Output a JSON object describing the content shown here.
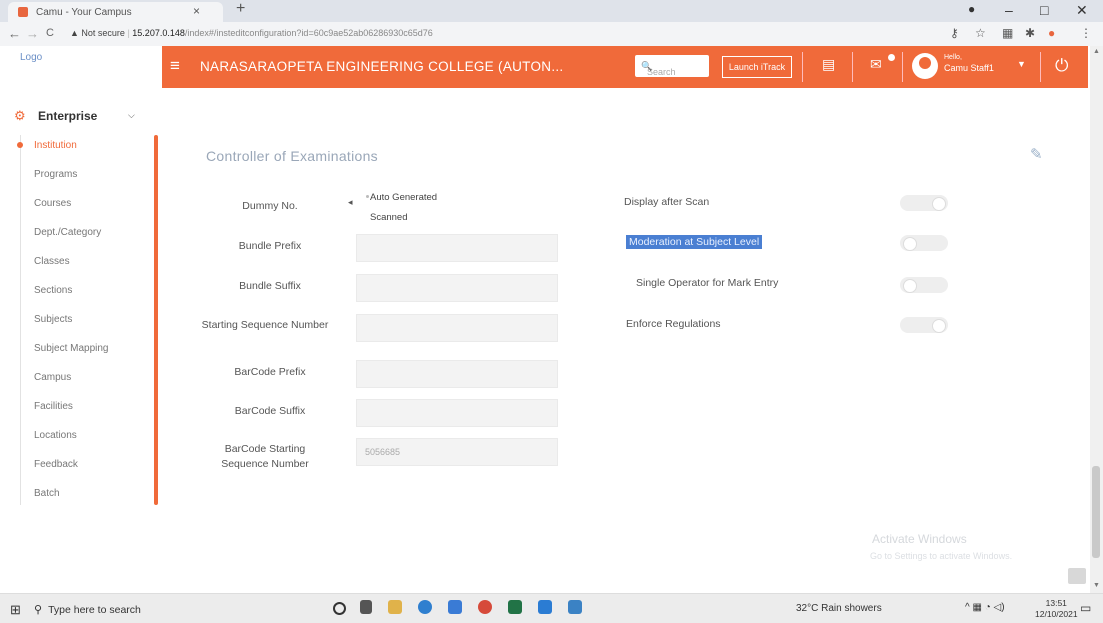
{
  "browser": {
    "tab_title": "Camu - Your Campus",
    "tab_close": "×",
    "new_tab": "+",
    "back": "←",
    "forward": "→",
    "reload": "C",
    "security": "▲ Not secure",
    "url_host": "15.207.0.148",
    "url_path": "/index#/insteditconfiguration?id=60c9ae52ab06286930c65d76",
    "min": "–",
    "max": "□",
    "close": "✕"
  },
  "app": {
    "logo_alt": "Logo",
    "college_name": "NARASARAOPETA ENGINEERING COLLEGE (AUTON...",
    "search_placeholder": "Search",
    "launch_button": "Launch iTrack",
    "hello": "Hello,",
    "user_name": "Camu Staff1"
  },
  "sidebar": {
    "section": "Enterprise",
    "items": [
      {
        "label": "Institution",
        "active": true
      },
      {
        "label": "Programs"
      },
      {
        "label": "Courses"
      },
      {
        "label": "Dept./Category"
      },
      {
        "label": "Classes"
      },
      {
        "label": "Sections"
      },
      {
        "label": "Subjects"
      },
      {
        "label": "Subject Mapping"
      },
      {
        "label": "Campus"
      },
      {
        "label": "Facilities"
      },
      {
        "label": "Locations"
      },
      {
        "label": "Feedback"
      },
      {
        "label": "Batch"
      }
    ]
  },
  "main": {
    "section_title": "Controller of Examinations",
    "dummy_no_label": "Dummy No.",
    "dummy_options": [
      "Auto Generated",
      "Scanned"
    ],
    "fields": [
      {
        "label": "Bundle Prefix",
        "value": ""
      },
      {
        "label": "Bundle Suffix",
        "value": ""
      },
      {
        "label": "Starting Sequence Number",
        "value": ""
      },
      {
        "label": "BarCode Prefix",
        "value": ""
      },
      {
        "label": "BarCode Suffix",
        "value": ""
      },
      {
        "label": "BarCode Starting Sequence Number",
        "value": "5056685"
      }
    ],
    "toggles": [
      {
        "label": "Display after Scan",
        "on": true
      },
      {
        "label": "Moderation at Subject Level",
        "on": false
      },
      {
        "label": "Single Operator for Mark Entry",
        "on": false
      },
      {
        "label": "Enforce Regulations",
        "on": true
      }
    ]
  },
  "watermark": {
    "line1": "Activate Windows",
    "line2": "Go to Settings to activate Windows."
  },
  "taskbar": {
    "search": "Type here to search",
    "weather": "32°C  Rain showers",
    "time": "13:51",
    "date": "12/10/2021"
  }
}
